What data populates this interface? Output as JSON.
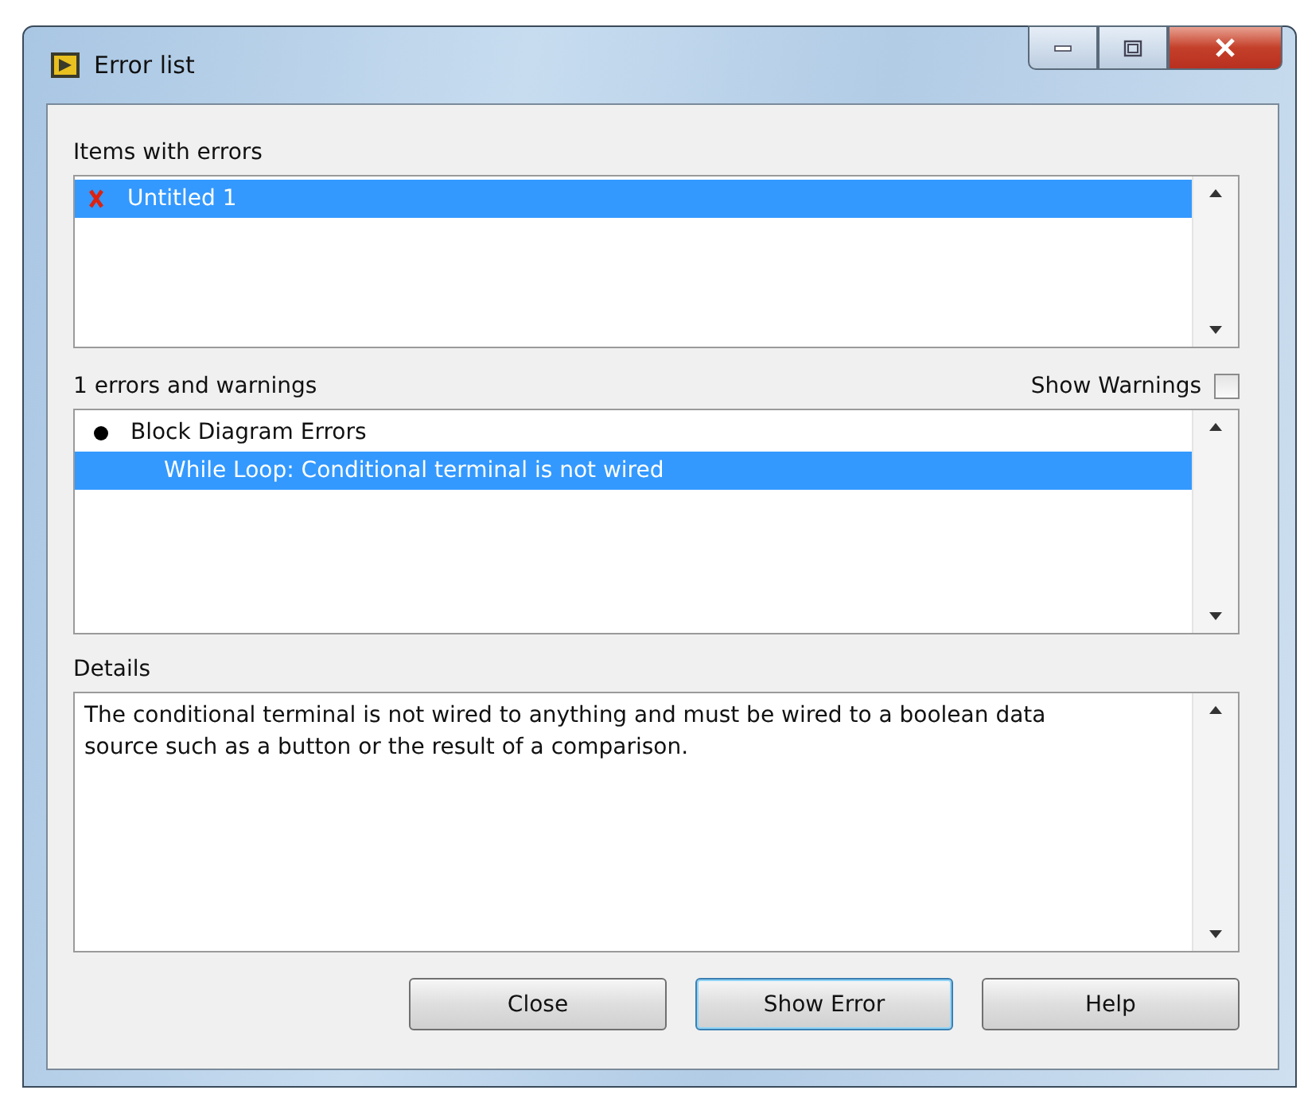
{
  "window": {
    "title": "Error list"
  },
  "items_with_errors": {
    "label": "Items with errors",
    "items": [
      {
        "label": "Untitled 1",
        "selected": true
      }
    ]
  },
  "errors": {
    "summary": "1 errors and warnings",
    "show_warnings": {
      "label": "Show Warnings",
      "checked": false
    },
    "groups": [
      {
        "label": "Block Diagram Errors",
        "selected": false,
        "children": [
          {
            "label": "While Loop: Conditional terminal is not wired",
            "selected": true
          }
        ]
      }
    ]
  },
  "details": {
    "label": "Details",
    "text": "The conditional terminal is not wired to anything and must be wired to a boolean data source such as a button or the result of a comparison."
  },
  "buttons": [
    {
      "label": "Close",
      "default": false
    },
    {
      "label": "Show Error",
      "default": true
    },
    {
      "label": "Help",
      "default": false
    }
  ]
}
